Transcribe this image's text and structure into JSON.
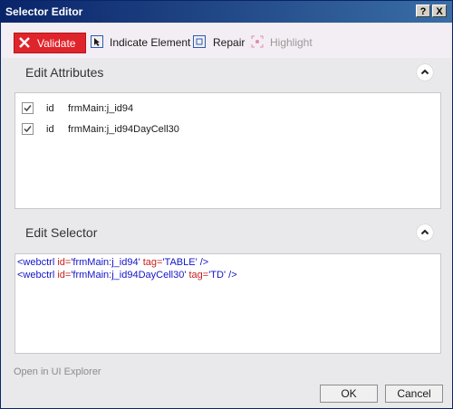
{
  "window": {
    "title": "Selector Editor",
    "help_label": "?",
    "close_label": "X"
  },
  "toolbar": {
    "validate_label": "Validate",
    "indicate_label": "Indicate Element",
    "repair_label": "Repair",
    "highlight_label": "Highlight"
  },
  "attributes": {
    "title": "Edit Attributes",
    "rows": [
      {
        "checked": true,
        "name": "id",
        "value": "frmMain:j_id94"
      },
      {
        "checked": true,
        "name": "id",
        "value": "frmMain:j_id94DayCell30"
      }
    ]
  },
  "selector": {
    "title": "Edit Selector",
    "lines": [
      {
        "open": "<webctrl ",
        "k1": "id=",
        "v1": "'frmMain:j_id94'",
        "k2": " tag=",
        "v2": "'TABLE'",
        "close": " />"
      },
      {
        "open": "<webctrl ",
        "k1": "id=",
        "v1": "'frmMain:j_id94DayCell30'",
        "k2": " tag=",
        "v2": "'TD'",
        "close": " />"
      }
    ]
  },
  "footer": {
    "open_link": "Open in UI Explorer",
    "ok_label": "OK",
    "cancel_label": "Cancel"
  },
  "colors": {
    "validate_red": "#e0242b",
    "title_blue": "#0a246a"
  }
}
